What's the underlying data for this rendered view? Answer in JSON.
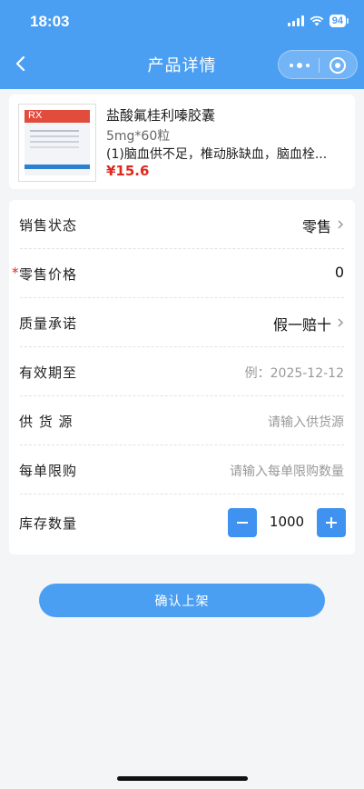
{
  "status_bar": {
    "time": "18:03",
    "battery": "94"
  },
  "nav": {
    "title": "产品详情"
  },
  "product": {
    "name": "盐酸氟桂利嗪胶囊",
    "spec": "5mg*60粒",
    "description": "(1)脑血供不足，椎动脉缺血，脑血栓...",
    "price": "¥15.6",
    "image_label": "RX"
  },
  "form": {
    "sales_status": {
      "label": "销售状态",
      "value": "零售"
    },
    "retail_price": {
      "label": "零售价格",
      "required_mark": "*",
      "value": "0"
    },
    "quality_promise": {
      "label": "质量承诺",
      "value": "假一赔十"
    },
    "expiry": {
      "label": "有效期至",
      "placeholder": "例：2025-12-12"
    },
    "supplier": {
      "label": "供 货 源",
      "placeholder": "请输入供货源"
    },
    "order_limit": {
      "label": "每单限购",
      "placeholder": "请输入每单限购数量"
    },
    "stock": {
      "label": "库存数量",
      "value": "1000"
    }
  },
  "actions": {
    "confirm_label": "确认上架"
  },
  "colors": {
    "primary": "#4b9ff2",
    "price": "#e0291d",
    "background": "#f4f5f7"
  }
}
